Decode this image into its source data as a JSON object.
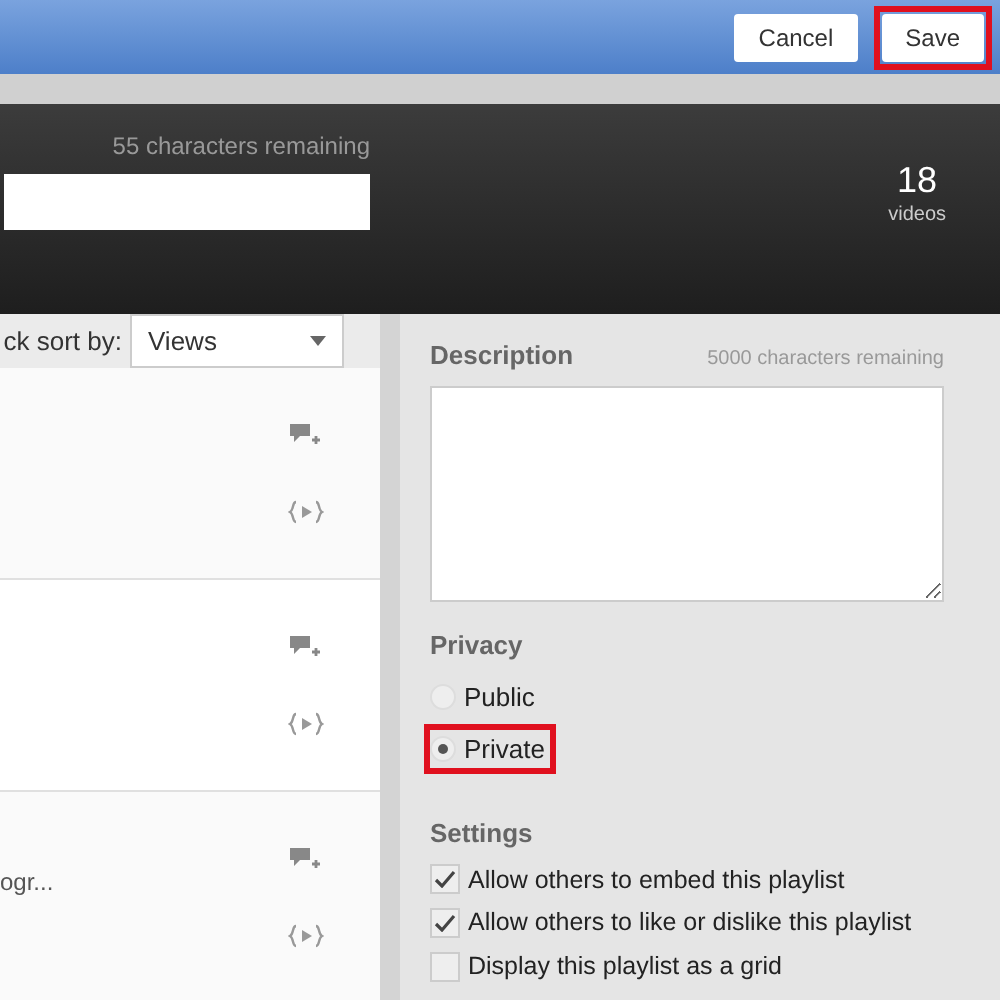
{
  "top_bar": {
    "buttons": [
      {
        "label": "Cancel",
        "highlighted": false
      },
      {
        "label": "Save",
        "highlighted": true
      }
    ]
  },
  "header": {
    "title_counter": "55 characters remaining",
    "video_count": "18",
    "video_count_label": "videos"
  },
  "sort": {
    "label": "ck sort by:",
    "value": "Views"
  },
  "videos": [
    {
      "kind": "untitled"
    },
    {
      "kind": "untitled"
    },
    {
      "kind": "titled",
      "title": "ogr..."
    }
  ],
  "description": {
    "label": "Description",
    "counter": "5000 characters remaining"
  },
  "privacy": {
    "label": "Privacy",
    "options": [
      {
        "label": "Public",
        "selected": false,
        "highlighted": false
      },
      {
        "label": "Private",
        "selected": true,
        "highlighted": true
      }
    ]
  },
  "settings": {
    "label": "Settings",
    "options": [
      {
        "label": "Allow others to embed this playlist",
        "checked": true
      },
      {
        "label": "Allow others to like or dislike this playlist",
        "checked": true
      },
      {
        "label": "Display this playlist as a grid",
        "checked": false
      }
    ]
  }
}
